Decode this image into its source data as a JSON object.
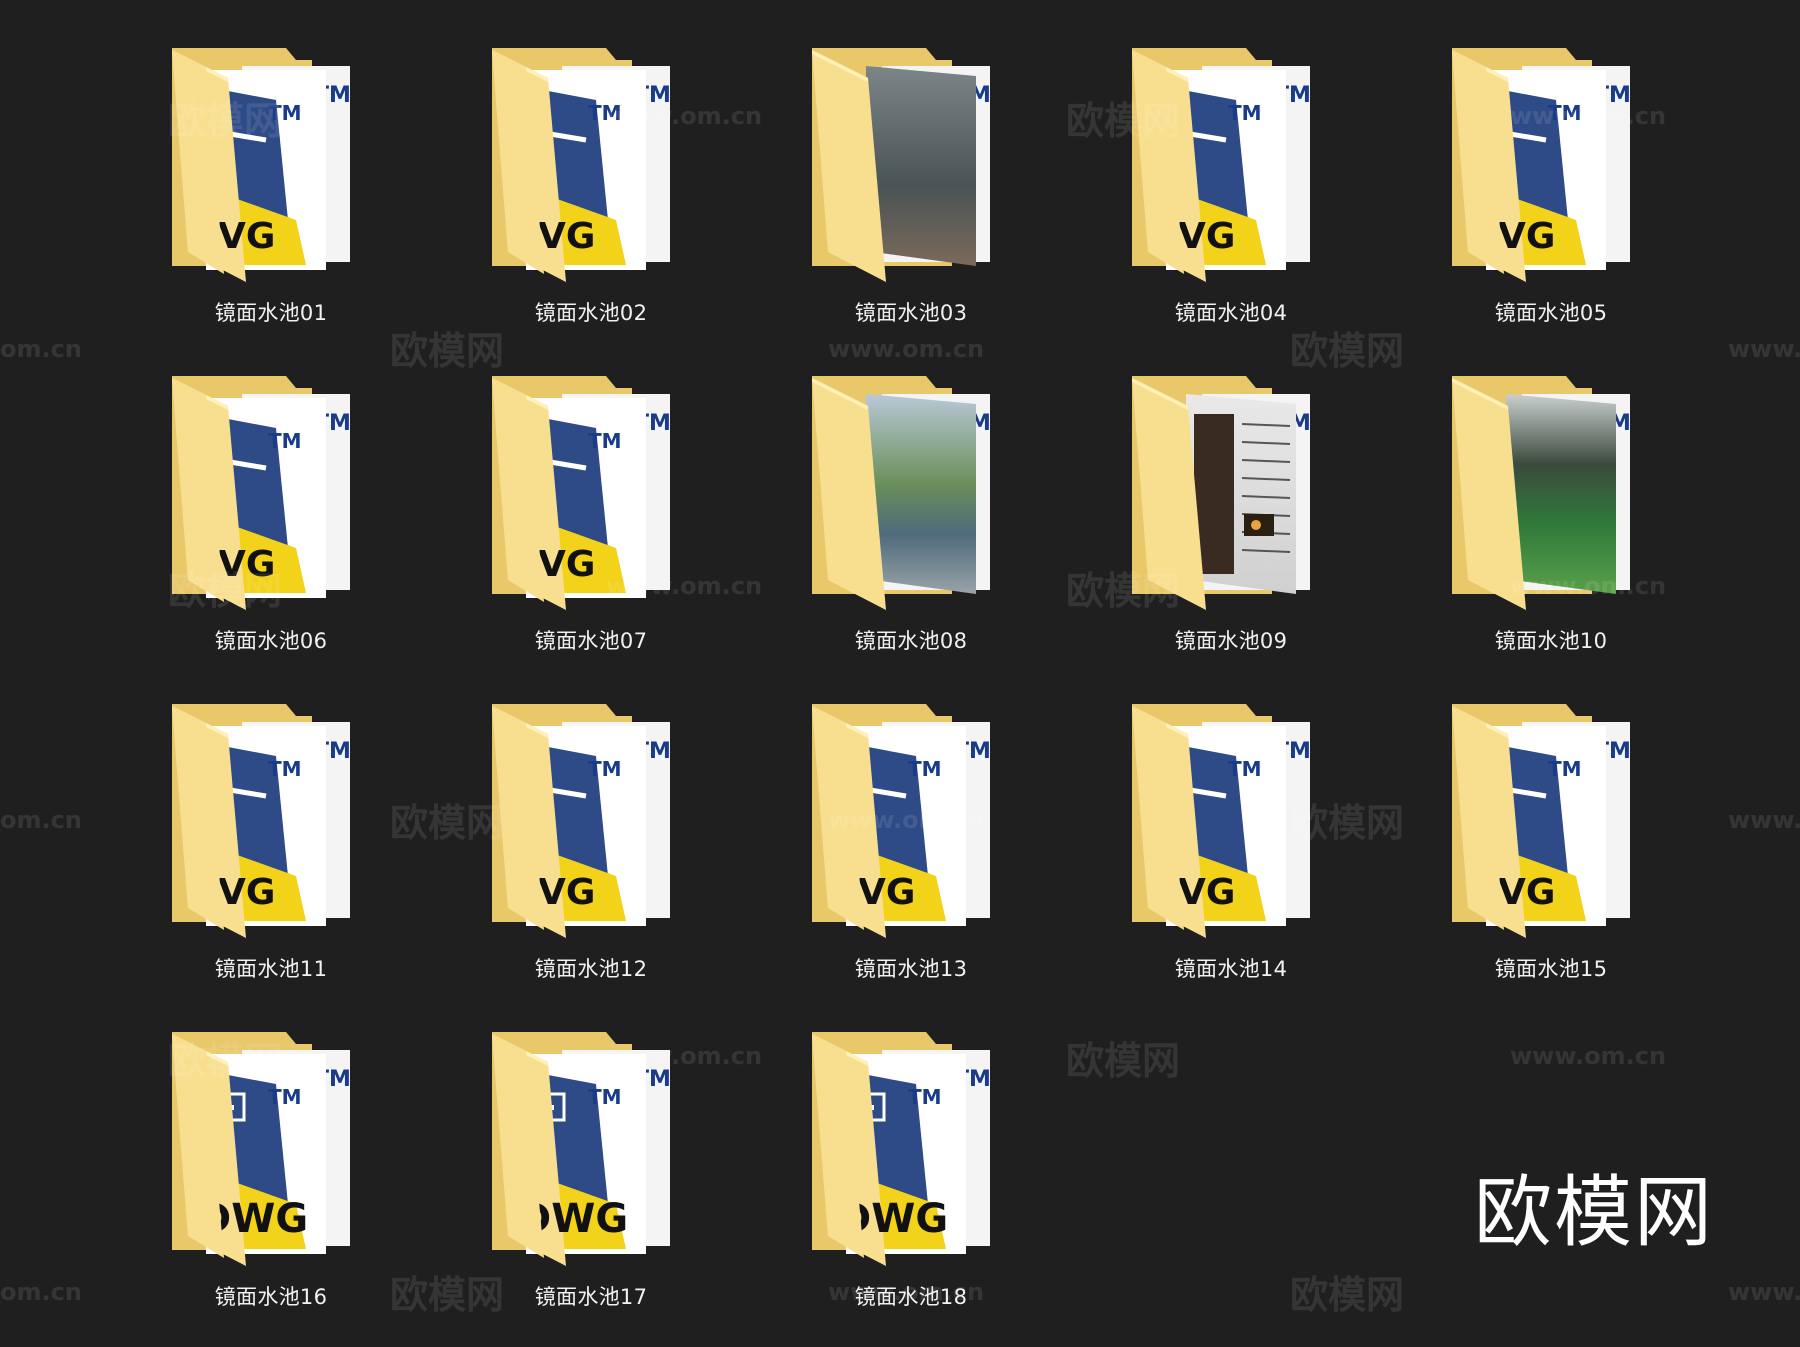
{
  "files": [
    {
      "name": "镜面水池01",
      "thumb": "dwg"
    },
    {
      "name": "镜面水池02",
      "thumb": "dwg"
    },
    {
      "name": "镜面水池03",
      "thumb": "water-photo"
    },
    {
      "name": "镜面水池04",
      "thumb": "dwg"
    },
    {
      "name": "镜面水池05",
      "thumb": "dwg"
    },
    {
      "name": "镜面水池06",
      "thumb": "dwg"
    },
    {
      "name": "镜面水池07",
      "thumb": "dwg"
    },
    {
      "name": "镜面水池08",
      "thumb": "sky-photo"
    },
    {
      "name": "镜面水池09",
      "thumb": "drawing-sheet"
    },
    {
      "name": "镜面水池10",
      "thumb": "garden-photo"
    },
    {
      "name": "镜面水池11",
      "thumb": "dwg"
    },
    {
      "name": "镜面水池12",
      "thumb": "dwg"
    },
    {
      "name": "镜面水池13",
      "thumb": "dwg"
    },
    {
      "name": "镜面水池14",
      "thumb": "dwg"
    },
    {
      "name": "镜面水池15",
      "thumb": "dwg"
    },
    {
      "name": "镜面水池16",
      "thumb": "dwg-large"
    },
    {
      "name": "镜面水池17",
      "thumb": "dwg-large"
    },
    {
      "name": "镜面水池18",
      "thumb": "dwg-large"
    }
  ],
  "icon_text": {
    "tm": "TM",
    "dwg_short": "VG",
    "dwg_long": "DWG"
  },
  "watermarks": {
    "site_name": "欧模网",
    "site_url": "www.om.cn",
    "site_url_cut": "om.cn",
    "site_url_cut_left": "www."
  },
  "brand": "欧模网",
  "colors": {
    "background": "#1f1f1f",
    "folder_back": "#e9c86a",
    "folder_front": "#f8df8f",
    "dwg_blue": "#2e4b87",
    "dwg_yellow": "#f3d21a"
  }
}
